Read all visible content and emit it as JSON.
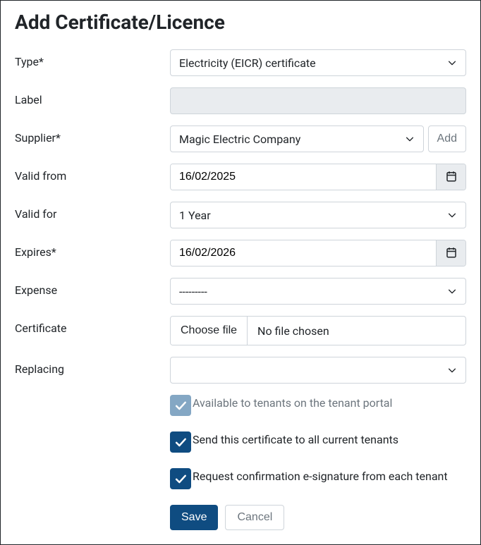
{
  "title": "Add Certificate/Licence",
  "form": {
    "type": {
      "label": "Type*",
      "value": "Electricity (EICR) certificate"
    },
    "label_field": {
      "label": "Label",
      "value": ""
    },
    "supplier": {
      "label": "Supplier*",
      "value": "Magic Electric Company",
      "add_label": "Add"
    },
    "valid_from": {
      "label": "Valid from",
      "value": "16/02/2025"
    },
    "valid_for": {
      "label": "Valid for",
      "value": "1 Year"
    },
    "expires": {
      "label": "Expires*",
      "value": "16/02/2026"
    },
    "expense": {
      "label": "Expense",
      "value": "---------"
    },
    "certificate": {
      "label": "Certificate",
      "button": "Choose file",
      "status": "No file chosen"
    },
    "replacing": {
      "label": "Replacing",
      "value": ""
    }
  },
  "checkboxes": {
    "tenant_portal": "Available to tenants on the tenant portal",
    "send_all": "Send this certificate to all current tenants",
    "esign": "Request confirmation e-signature from each tenant"
  },
  "actions": {
    "save": "Save",
    "cancel": "Cancel"
  }
}
